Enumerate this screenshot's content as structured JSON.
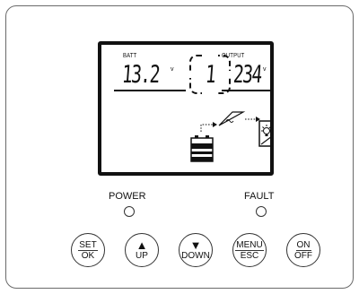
{
  "lcd": {
    "batt_label": "BATT",
    "batt_value": "13.2",
    "batt_unit": "v",
    "mode_value": "1",
    "output_label": "OUTPUT",
    "output_value": "234",
    "output_unit": "v",
    "icons": [
      "battery-icon",
      "dotted-arrow-icon",
      "ac-wave-icon",
      "dotted-arrow-icon",
      "bulb-load-icon"
    ]
  },
  "indicators": {
    "power_label": "POWER",
    "fault_label": "FAULT"
  },
  "buttons": {
    "set_ok": {
      "top": "SET",
      "bottom": "OK"
    },
    "up": {
      "symbol": "▲",
      "label": "UP"
    },
    "down": {
      "symbol": "▼",
      "label": "DOWN"
    },
    "menu_esc": {
      "top": "MENU",
      "bottom": "ESC"
    },
    "on_off": {
      "top": "ON",
      "bottom": "OFF"
    }
  }
}
